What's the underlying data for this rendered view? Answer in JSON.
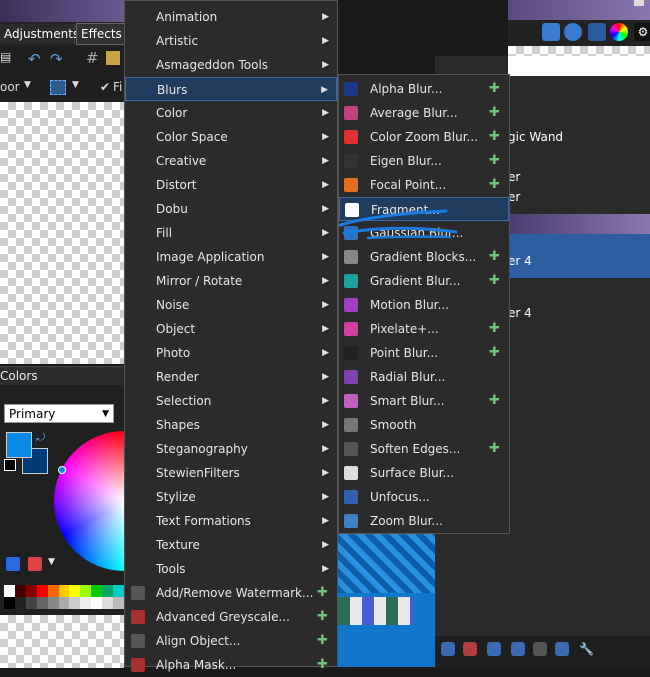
{
  "tabs": {
    "adjustments": "Adjustments",
    "effects": "Effects"
  },
  "toolbar": {
    "zoom_label": "oor",
    "fi_label": "Fi"
  },
  "colors_panel": {
    "title": "Colors",
    "primary_select": "Primary"
  },
  "layers_panel": {
    "tool_hint": "gic Wand",
    "row1": "er",
    "row2": "er",
    "layer_sel": "er 4",
    "layer2": "er 4"
  },
  "effects_menu": {
    "items": [
      {
        "label": "Animation",
        "submenu": true
      },
      {
        "label": "Artistic",
        "submenu": true
      },
      {
        "label": "Asmageddon Tools",
        "submenu": true
      },
      {
        "label": "Blurs",
        "submenu": true,
        "highlighted": true
      },
      {
        "label": "Color",
        "submenu": true
      },
      {
        "label": "Color Space",
        "submenu": true
      },
      {
        "label": "Creative",
        "submenu": true
      },
      {
        "label": "Distort",
        "submenu": true
      },
      {
        "label": "Dobu",
        "submenu": true
      },
      {
        "label": "Fill",
        "submenu": true
      },
      {
        "label": "Image Application",
        "submenu": true
      },
      {
        "label": "Mirror / Rotate",
        "submenu": true
      },
      {
        "label": "Noise",
        "submenu": true
      },
      {
        "label": "Object",
        "submenu": true
      },
      {
        "label": "Photo",
        "submenu": true
      },
      {
        "label": "Render",
        "submenu": true
      },
      {
        "label": "Selection",
        "submenu": true
      },
      {
        "label": "Shapes",
        "submenu": true
      },
      {
        "label": "Steganography",
        "submenu": true
      },
      {
        "label": "StewienFilters",
        "submenu": true
      },
      {
        "label": "Stylize",
        "submenu": true
      },
      {
        "label": "Text Formations",
        "submenu": true
      },
      {
        "label": "Texture",
        "submenu": true
      },
      {
        "label": "Tools",
        "submenu": true
      },
      {
        "label": "Add/Remove Watermark...",
        "submenu": false,
        "plugin": true,
        "icon": "watermark-icon"
      },
      {
        "label": "Advanced Greyscale...",
        "submenu": false,
        "plugin": true,
        "icon": "greyscale-icon"
      },
      {
        "label": "Align Object...",
        "submenu": false,
        "plugin": true,
        "icon": "align-icon"
      },
      {
        "label": "Alpha Mask...",
        "submenu": false,
        "plugin": true,
        "icon": "alpha-mask-icon"
      }
    ]
  },
  "blurs_submenu": {
    "items": [
      {
        "label": "Alpha Blur...",
        "plugin": true,
        "icon": "alpha-blur-icon",
        "color": "#1a3a8a"
      },
      {
        "label": "Average Blur...",
        "plugin": true,
        "icon": "average-blur-icon",
        "color": "#c04080"
      },
      {
        "label": "Color Zoom Blur...",
        "plugin": true,
        "icon": "color-zoom-blur-icon",
        "color": "#e03030"
      },
      {
        "label": "Eigen Blur...",
        "plugin": true,
        "icon": "eigen-blur-icon",
        "color": "#333333"
      },
      {
        "label": "Focal Point...",
        "plugin": true,
        "icon": "focal-point-icon",
        "color": "#e07020"
      },
      {
        "label": "Fragment...",
        "plugin": false,
        "icon": "fragment-icon",
        "color": "#ffffff",
        "highlighted": true
      },
      {
        "label": "Gaussian Blur...",
        "plugin": false,
        "icon": "gaussian-blur-icon",
        "color": "#3070c0"
      },
      {
        "label": "Gradient Blocks...",
        "plugin": true,
        "icon": "gradient-blocks-icon",
        "color": "#888888"
      },
      {
        "label": "Gradient Blur...",
        "plugin": true,
        "icon": "gradient-blur-icon",
        "color": "#20a0a0"
      },
      {
        "label": "Motion Blur...",
        "plugin": false,
        "icon": "motion-blur-icon",
        "color": "#a040c0"
      },
      {
        "label": "Pixelate+...",
        "plugin": true,
        "icon": "pixelate-icon",
        "color": "#d040a0"
      },
      {
        "label": "Point Blur...",
        "plugin": true,
        "icon": "point-blur-icon",
        "color": "#222222"
      },
      {
        "label": "Radial Blur...",
        "plugin": false,
        "icon": "radial-blur-icon",
        "color": "#8040b0"
      },
      {
        "label": "Smart Blur...",
        "plugin": true,
        "icon": "smart-blur-icon",
        "color": "#c060c0"
      },
      {
        "label": "Smooth",
        "plugin": false,
        "icon": "smooth-icon",
        "color": "#777777"
      },
      {
        "label": "Soften Edges...",
        "plugin": true,
        "icon": "soften-edges-icon",
        "color": "#555555"
      },
      {
        "label": "Surface Blur...",
        "plugin": false,
        "icon": "surface-blur-icon",
        "color": "#dddddd"
      },
      {
        "label": "Unfocus...",
        "plugin": false,
        "icon": "unfocus-icon",
        "color": "#3060b0"
      },
      {
        "label": "Zoom Blur...",
        "plugin": false,
        "icon": "zoom-blur-icon",
        "color": "#4080c0"
      }
    ]
  },
  "colors": {
    "menu_bg": "#2b2b2b",
    "highlight": "#1f3c5e",
    "plugin_icon": "#6fc27a",
    "primary_swatch": "#0a8ae8",
    "secondary_swatch": "#003c7a",
    "layer_selected": "#2c5fa0",
    "scribble": "#1a7be0"
  }
}
